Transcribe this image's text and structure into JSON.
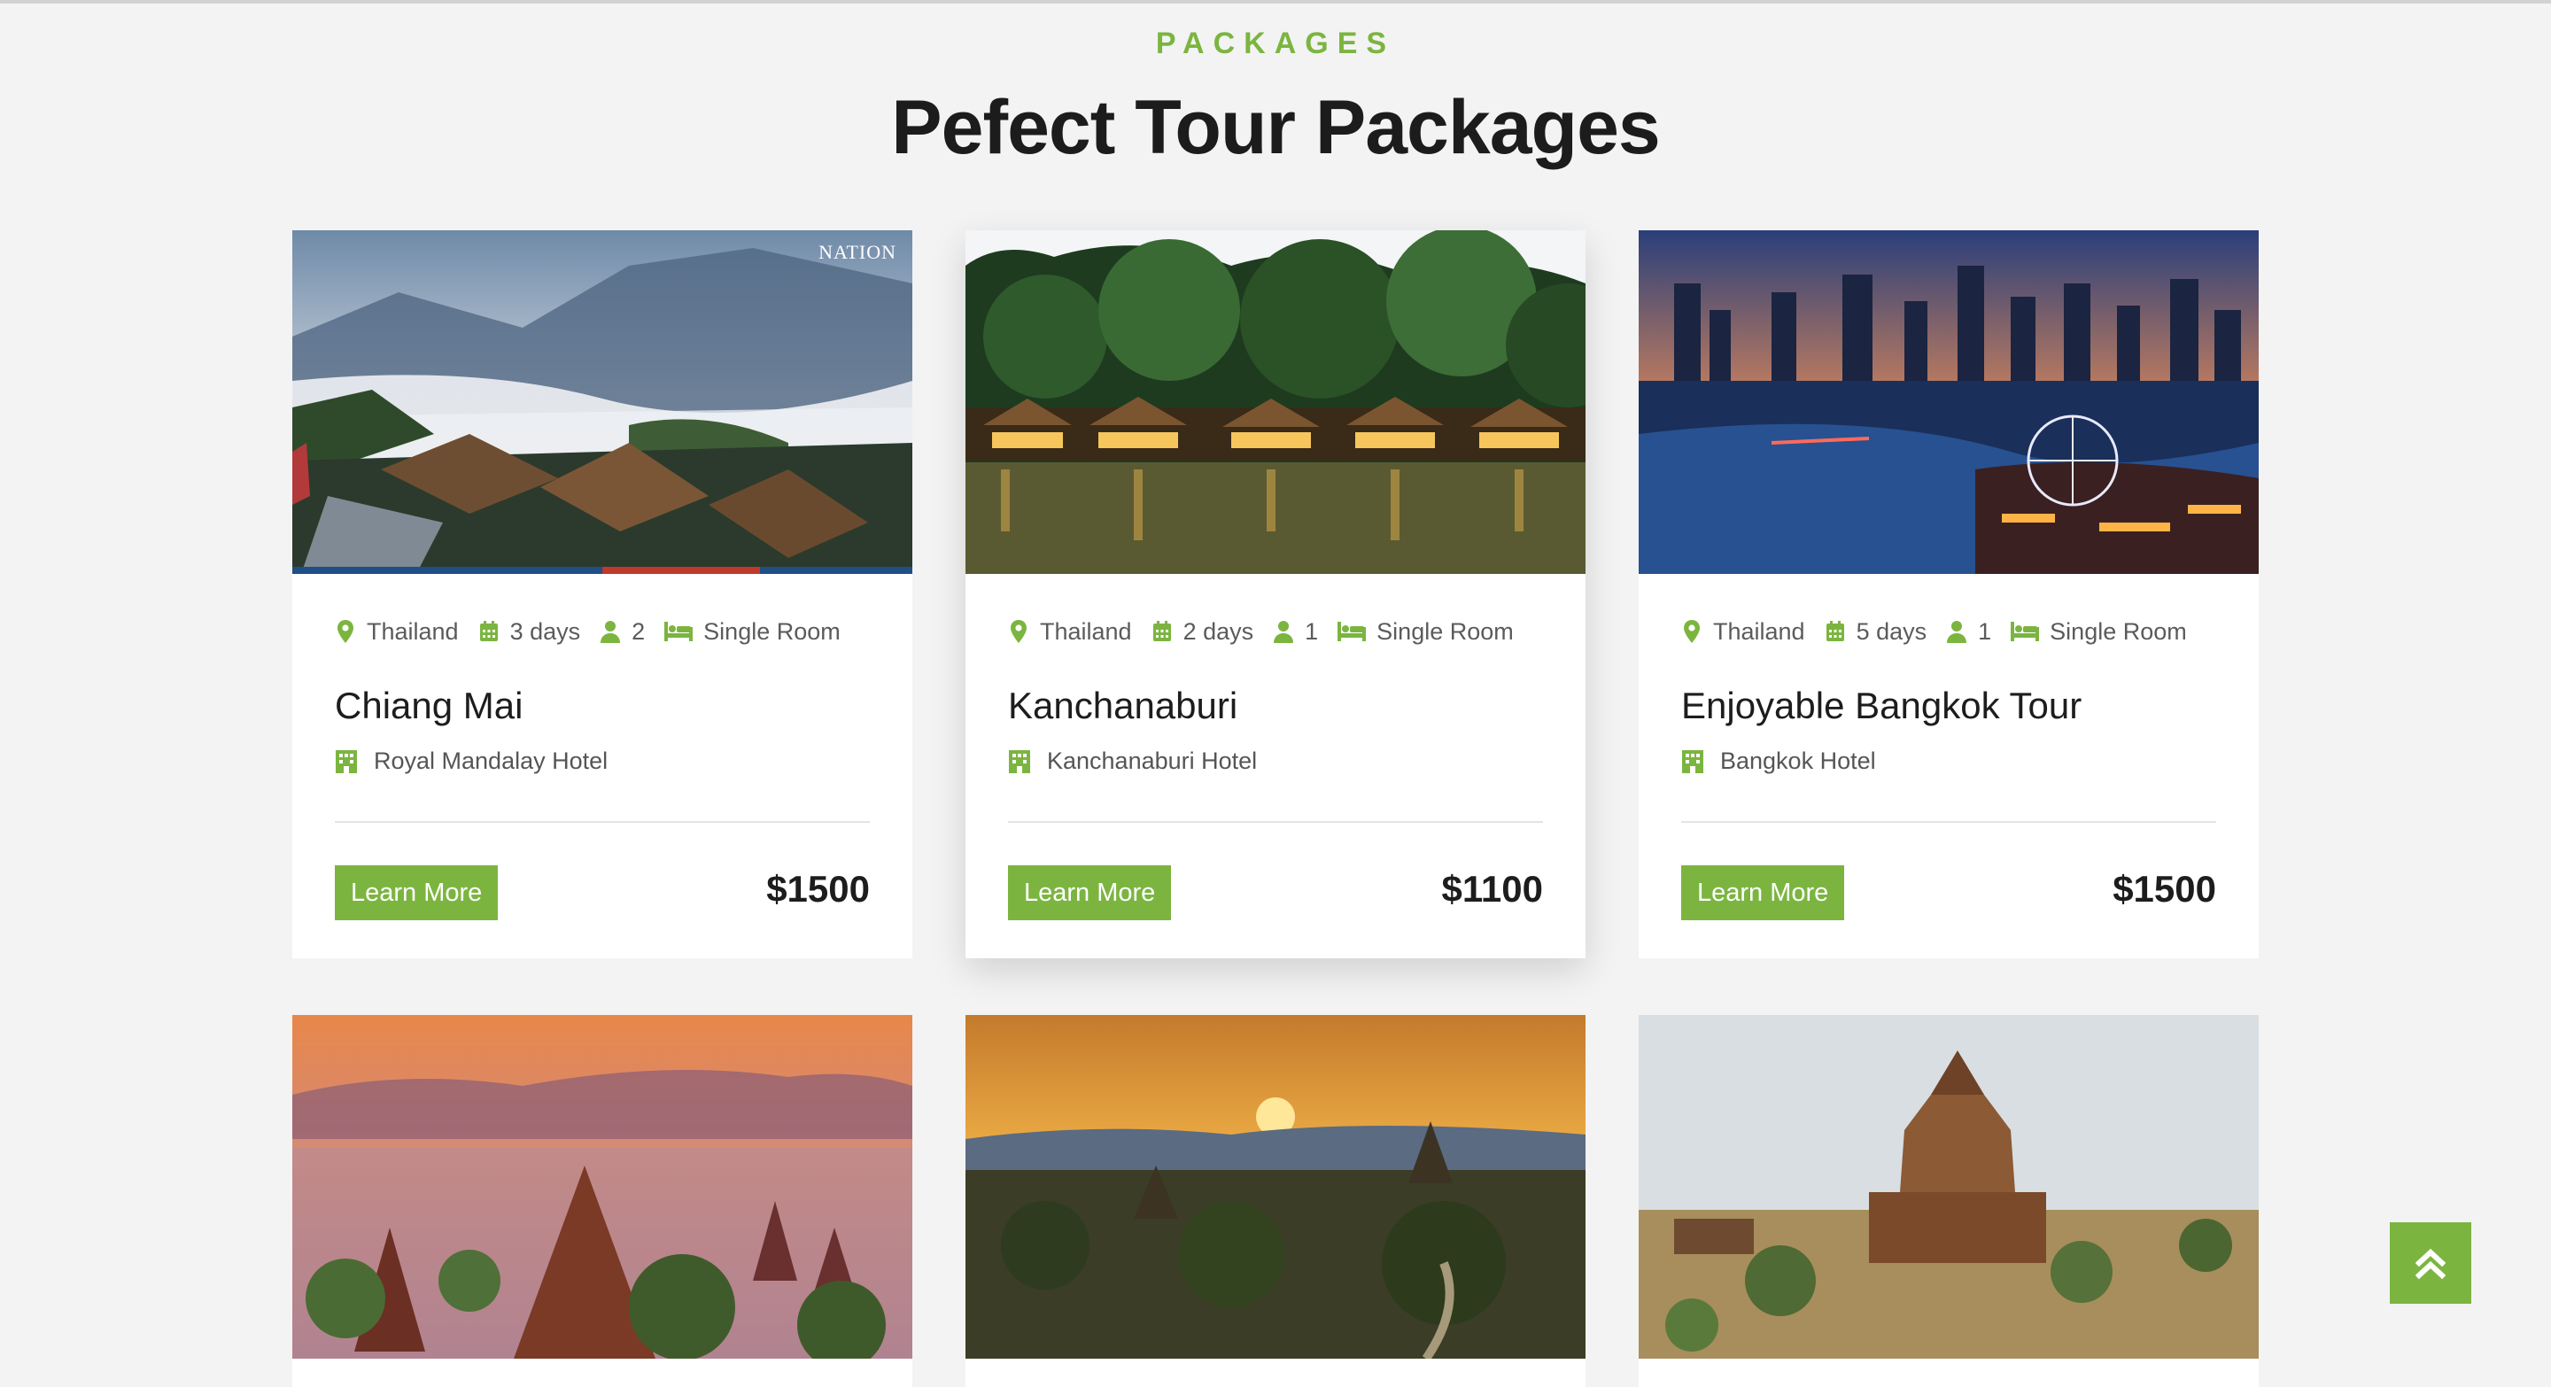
{
  "section": {
    "eyebrow": "PACKAGES",
    "title": "Pefect Tour Packages"
  },
  "colors": {
    "accent": "#7bb540",
    "page_bg": "#f3f3f3",
    "card_bg": "#ffffff",
    "text": "#1d1d1d"
  },
  "packages": [
    {
      "location": "Thailand",
      "duration": "3 days",
      "people": "2",
      "room": "Single Room",
      "title": "Chiang Mai",
      "hotel": "Royal Mandalay Hotel",
      "cta": "Learn More",
      "price": "$1500",
      "image": "misty-mountain-village",
      "watermark": "NATION"
    },
    {
      "location": "Thailand",
      "duration": "2 days",
      "people": "1",
      "room": "Single Room",
      "title": "Kanchanaburi",
      "hotel": "Kanchanaburi Hotel",
      "cta": "Learn More",
      "price": "$1100",
      "image": "river-floating-bungalows"
    },
    {
      "location": "Thailand",
      "duration": "5 days",
      "people": "1",
      "room": "Single Room",
      "title": "Enjoyable Bangkok Tour",
      "hotel": "Bangkok Hotel",
      "cta": "Learn More",
      "price": "$1500",
      "image": "bangkok-city-river-night"
    },
    {
      "image": "bagan-pagodas-sunrise-mist"
    },
    {
      "image": "bagan-plain-sunset"
    },
    {
      "image": "bagan-large-temple"
    }
  ],
  "icons": {
    "location": "map-pin-icon",
    "duration": "calendar-icon",
    "people": "user-icon",
    "room": "bed-icon",
    "hotel": "building-icon",
    "scroll_top": "double-chevron-up-icon"
  }
}
